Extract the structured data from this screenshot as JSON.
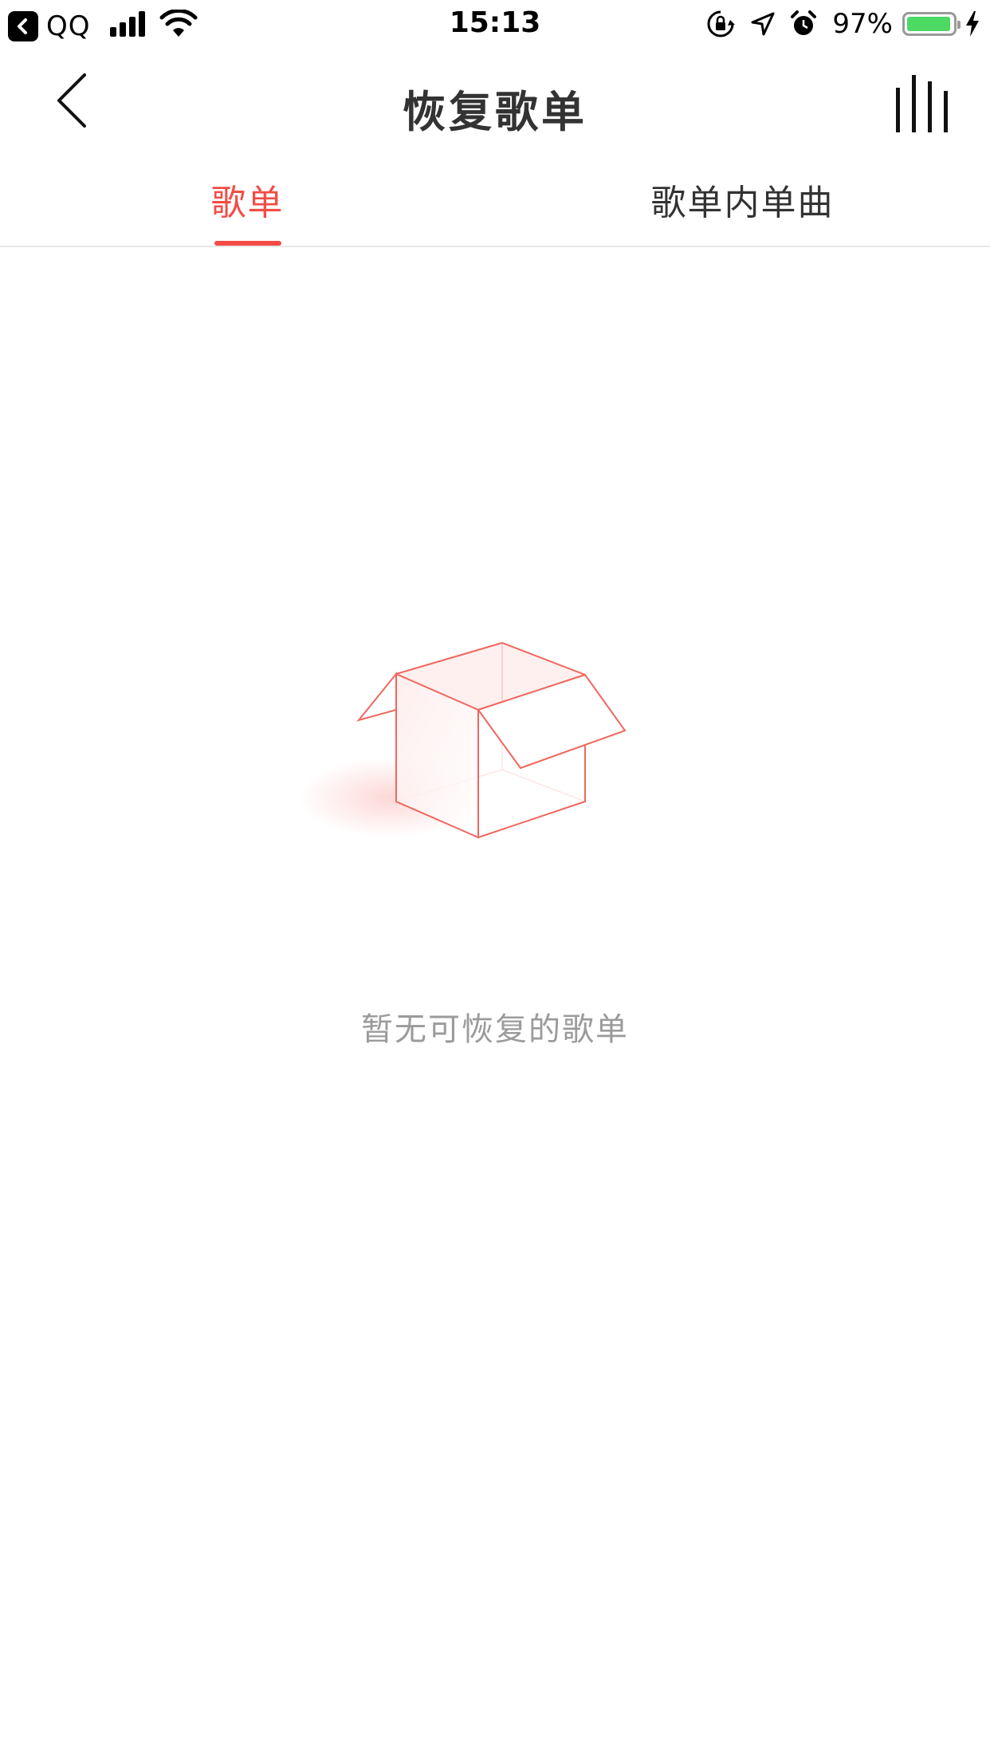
{
  "status_bar": {
    "back_app_name": "QQ",
    "time": "15:13",
    "battery_percent": "97%",
    "battery_level": 0.97,
    "icons": [
      "back-to-app-icon",
      "signal-icon",
      "wifi-icon",
      "rotation-lock-icon",
      "location-icon",
      "alarm-icon",
      "battery-icon",
      "charging-icon"
    ]
  },
  "nav": {
    "title": "恢复歌单",
    "icons": [
      "back-arrow-icon",
      "now-playing-icon"
    ]
  },
  "tabs": [
    {
      "label": "歌单",
      "active": true
    },
    {
      "label": "歌单内单曲",
      "active": false
    }
  ],
  "empty_state": {
    "icon": "empty-box-icon",
    "message": "暂无可恢复的歌单"
  },
  "colors": {
    "accent": "#f24d45",
    "text_primary": "#333333",
    "text_secondary": "#9b9b9b",
    "battery_green": "#4cd964"
  }
}
